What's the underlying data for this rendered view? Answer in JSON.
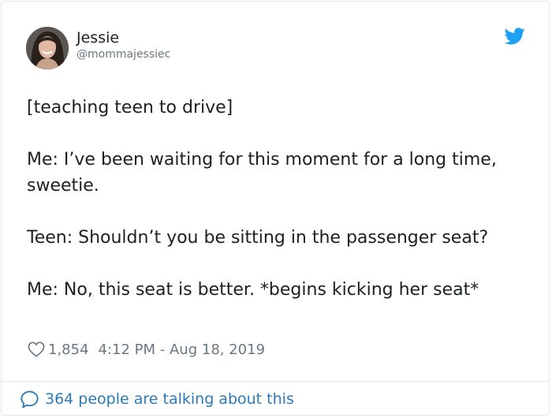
{
  "author": {
    "display_name": "Jessie",
    "handle": "@mommajessiec",
    "avatar_icon": "profile-photo"
  },
  "brand": {
    "logo_icon": "twitter-bird-icon",
    "accent_color": "#1da1f2"
  },
  "tweet": {
    "paragraphs": [
      "[teaching teen to drive]",
      "Me: I’ve been waiting for this moment for a long time, sweetie.",
      "Teen: Shouldn’t you be sitting in the passenger seat?",
      "Me: No, this seat is better. *begins kicking her seat*"
    ]
  },
  "meta": {
    "like_icon": "heart-icon",
    "likes": "1,854",
    "timestamp": "4:12 PM - Aug 18, 2019"
  },
  "footer": {
    "icon": "speech-bubble-icon",
    "link_text": "364 people are talking about this",
    "link_color": "#2b7bb9"
  }
}
